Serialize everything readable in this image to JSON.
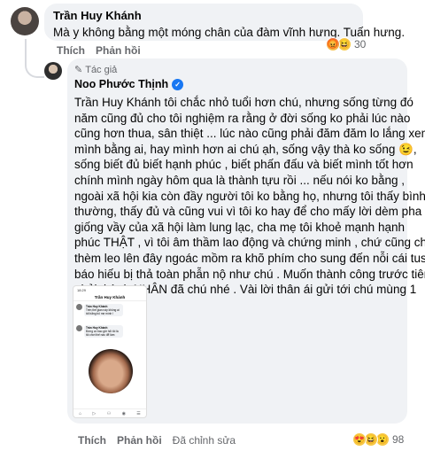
{
  "comment1": {
    "author": "Trần Huy Khánh",
    "text": "Mà y không bằng một móng chân của đàm vĩnh hưng. Tuấn hưng.",
    "actions": [
      "Thích",
      "Phản hồi"
    ],
    "reaction_count": "30",
    "reaction_icons": [
      "angry-face",
      "laughing-face"
    ]
  },
  "comment2": {
    "author_tag": "Tác giả",
    "author": "Noo Phước Thịnh",
    "verified": "✓",
    "lines": [
      "Trần Huy Khánh tôi chắc nhỏ tuổi hơn chú, nhưng sống từng đó",
      "năm cũng đủ cho tôi nghiệm ra rằng ở đời sống ko phải lúc nào",
      "cũng hơn thua, sân thiệt ... lúc nào cũng phải đăm đăm lo lắng xem",
      "mình bằng ai, hay mình hơn ai chú ạh, sống vậy thà ko sống 😉,",
      "sống biết đủ biết hạnh phúc , biết phấn đấu và biết mình tốt hơn",
      "chính mình ngày hôm qua là thành tựu rồi ... nếu nói ko bằng ,",
      "ngoài xã hội kia còn đầy người tôi ko bằng họ, nhưng tôi thấy bình",
      "thường, thấy đủ và cũng vui vì tôi ko hay để cho mấy lời dèm pha",
      "giống vầy của xã hội làm lung lạc, cha mẹ tôi khoẻ mạnh hạnh",
      "phúc THẬT , vì tôi âm thầm lao động và chứng minh , chứ cũng chả",
      "thèm leo lên đây ngoác mồm ra khõ phím cho sung đến nỗi cái tus",
      "báo hiếu bị thả toàn phẫn nộ như chú . Muốn thành công trước tiên",
      "phải thành NHÂN đã chú nhé . Vài lời thân ái gửi tới chú mùng 1"
    ],
    "screenshot": {
      "time": "18:29",
      "title": "Trần Huy Khánh",
      "c1_name": "Trần Huy Khánh",
      "c1_text": "Trên thế gian này không ai tốt bằng bố mẹ mình !",
      "c2_name": "Trần Huy Khánh",
      "c2_text": "Đừng có bao giờ hỏi tôi là tôi chơi thế nào để làm",
      "bar": [
        "⌂",
        "▷",
        "⚇",
        "◉",
        "☰"
      ]
    },
    "actions": [
      "Thích",
      "Phản hồi"
    ],
    "edited": "Đã chỉnh sửa",
    "reaction_count": "98",
    "reaction_icons": [
      "heart-eyes-face",
      "laughing-face",
      "wow-face"
    ]
  },
  "colors": {
    "bubble": "#f0f2f5",
    "meta": "#65676b",
    "verified": "#1877f2"
  }
}
